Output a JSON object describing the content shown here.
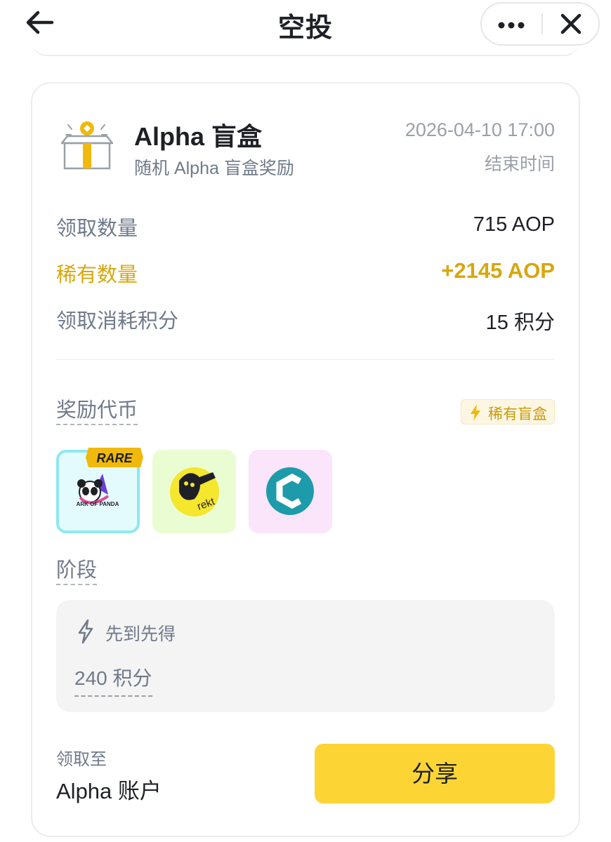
{
  "header": {
    "title": "空投",
    "back_icon": "arrow-left-icon",
    "more_icon": "more-dots-icon",
    "close_icon": "close-icon"
  },
  "card": {
    "icon": "gift-box-icon",
    "title": "Alpha 盲盒",
    "subtitle": "随机 Alpha 盲盒奖励",
    "end_time": "2026-04-10 17:00",
    "end_time_label": "结束时间",
    "rows": [
      {
        "label": "领取数量",
        "value": "715 AOP"
      },
      {
        "label": "稀有数量",
        "value": "+2145 AOP"
      },
      {
        "label": "领取消耗积分",
        "value": "15 积分"
      }
    ],
    "reward_tokens_title": "奖励代币",
    "rare_badge": "稀有盲盒",
    "tokens": [
      {
        "name": "ark-of-panda",
        "logo_text": "ARK OF PANDA",
        "tag": "RARE",
        "bg": "#e4fbfd"
      },
      {
        "name": "rekt",
        "logo_text": "rekt",
        "bg": "#eafdd2"
      },
      {
        "name": "c-token",
        "bg": "#fbe5fb"
      }
    ],
    "phase_title": "阶段",
    "phase": {
      "label": "先到先得",
      "points": "240 积分"
    },
    "claim_to_label": "领取至",
    "claim_to_value": "Alpha 账户",
    "share_button": "分享"
  },
  "colors": {
    "accent": "#fcd535",
    "rare": "#d7a70e",
    "muted": "#707a8a",
    "text": "#1e2026"
  }
}
